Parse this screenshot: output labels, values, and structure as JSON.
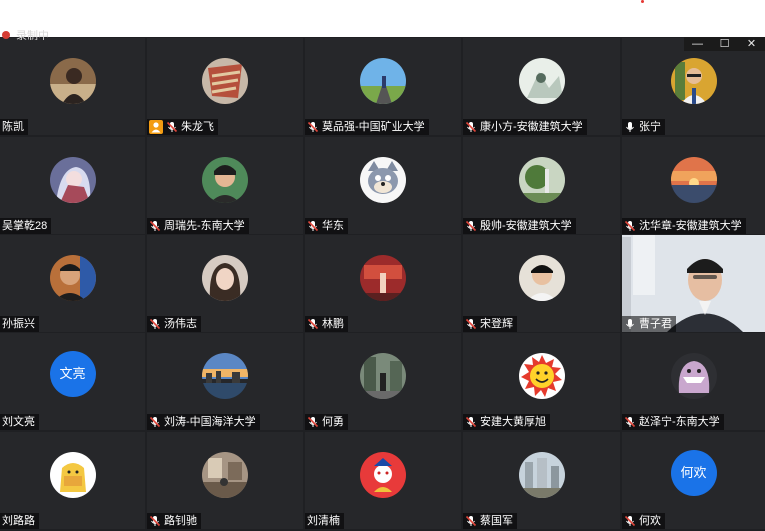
{
  "window": {
    "title": "录制中",
    "minimize_glyph": "—",
    "maximize_glyph": "☐",
    "close_glyph": "✕"
  },
  "participants": [
    {
      "name": "陈凯",
      "mic": "none",
      "avatar": "photo-person-dark"
    },
    {
      "name": "朱龙飞",
      "mic": "muted",
      "host": true,
      "avatar": "photo-scarf"
    },
    {
      "name": "莫品强-中国矿业大学",
      "mic": "muted",
      "avatar": "photo-road-blue"
    },
    {
      "name": "康小方-安徽建筑大学",
      "mic": "muted",
      "avatar": "photo-light"
    },
    {
      "name": "张宁",
      "mic": "on",
      "avatar": "photo-man-glasses"
    },
    {
      "name": "吴掌乾28",
      "mic": "none",
      "avatar": "photo-anime-girl"
    },
    {
      "name": "周瑞先-东南大学",
      "mic": "muted",
      "avatar": "photo-boy"
    },
    {
      "name": "华东",
      "mic": "muted",
      "avatar": "cartoon-cat"
    },
    {
      "name": "殷帅-安徽建筑大学",
      "mic": "muted",
      "avatar": "photo-landscape-green"
    },
    {
      "name": "沈华章-安徽建筑大学",
      "mic": "muted",
      "avatar": "photo-sunset"
    },
    {
      "name": "孙振兴",
      "mic": "none",
      "avatar": "photo-man-smile"
    },
    {
      "name": "汤伟志",
      "mic": "muted",
      "avatar": "photo-girl-selfie"
    },
    {
      "name": "林鹏",
      "mic": "muted",
      "avatar": "photo-red-scene"
    },
    {
      "name": "宋登辉",
      "mic": "muted",
      "avatar": "photo-man-young"
    },
    {
      "name": "曹子君",
      "mic": "on",
      "avatar": "live-video",
      "active": true
    },
    {
      "name": "刘文亮",
      "mic": "none",
      "avatar_text": "文亮"
    },
    {
      "name": "刘涛-中国海洋大学",
      "mic": "muted",
      "avatar": "photo-city-sunset"
    },
    {
      "name": "何勇",
      "mic": "muted",
      "avatar": "photo-street"
    },
    {
      "name": "安建大黄厚旭",
      "mic": "muted",
      "avatar": "emoji-sun-smile"
    },
    {
      "name": "赵泽宁-东南大学",
      "mic": "muted",
      "avatar": "cartoon-shark"
    },
    {
      "name": "刘路路",
      "mic": "none",
      "avatar": "cartoon-yellow"
    },
    {
      "name": "路钊驰",
      "mic": "muted",
      "avatar": "photo-room"
    },
    {
      "name": "刘清楠",
      "mic": "none",
      "avatar": "cartoon-red-opera"
    },
    {
      "name": "蔡国军",
      "mic": "muted",
      "avatar": "photo-buildings"
    },
    {
      "name": "何欢",
      "mic": "muted",
      "avatar_text": "何欢"
    }
  ],
  "colors": {
    "tile_bg": "#26272a",
    "grid_bg": "#1f2023",
    "active_border": "#2fb56a",
    "muted_mic": "#e0463b",
    "text_avatar_bg": "#1a73e8"
  }
}
